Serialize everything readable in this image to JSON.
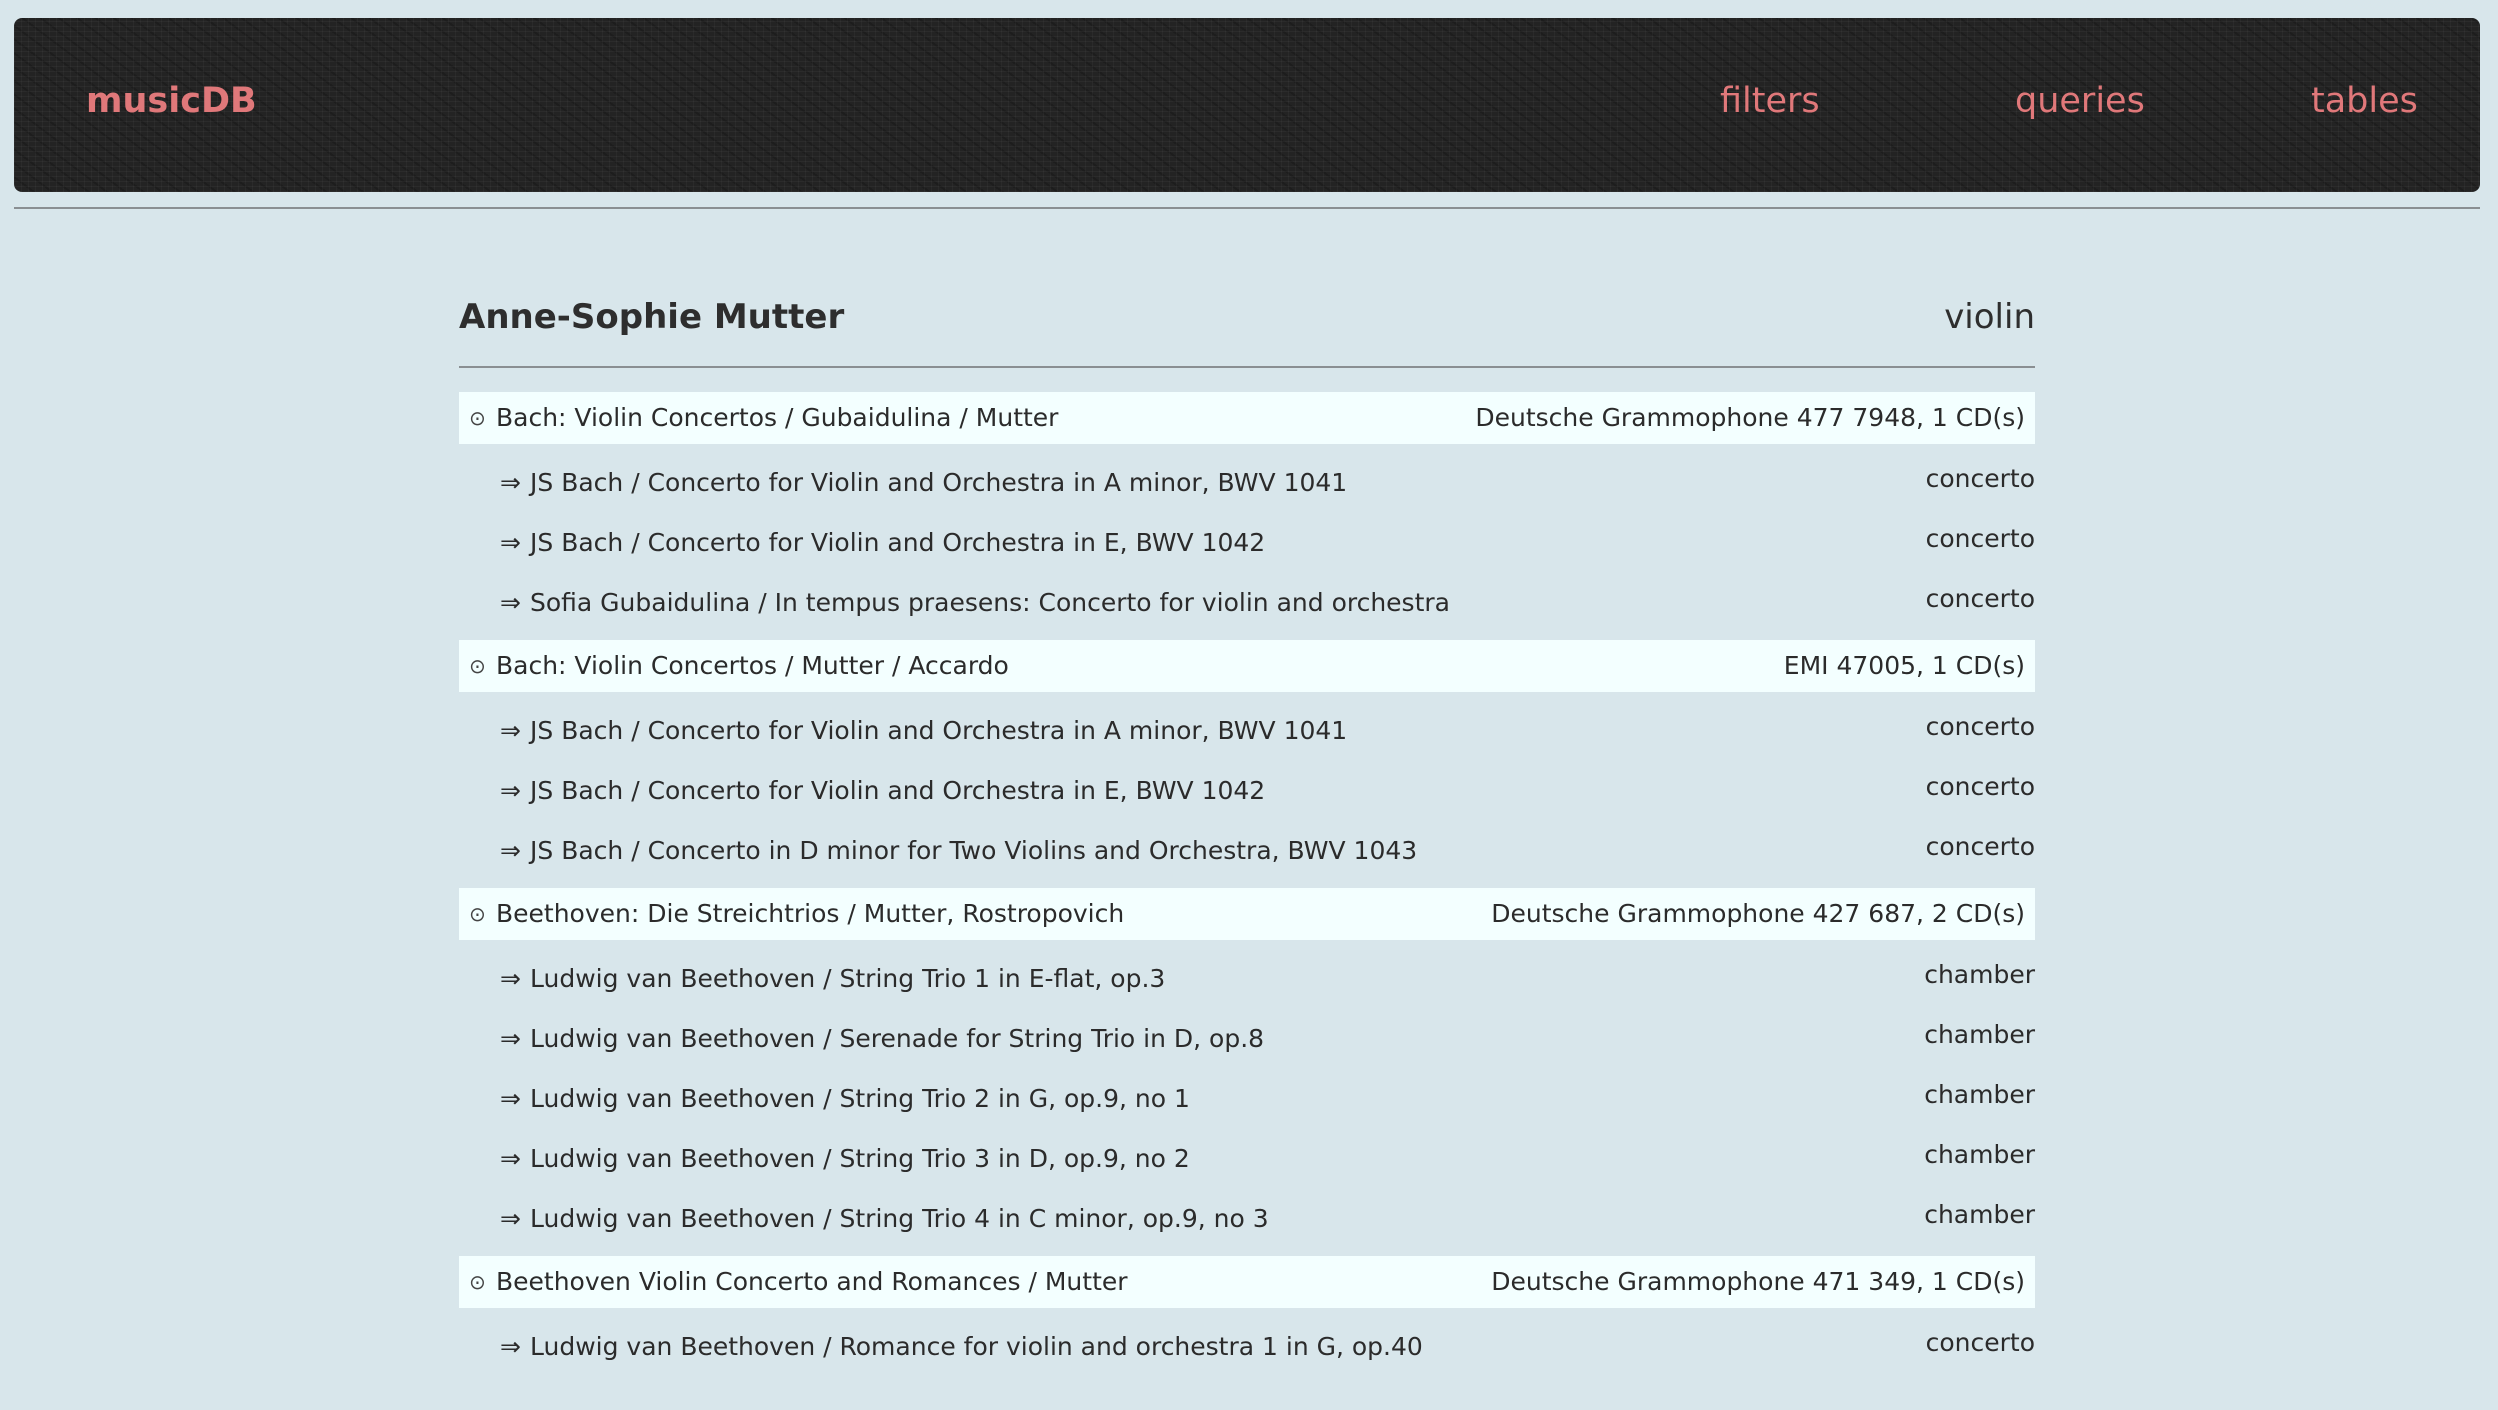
{
  "nav": {
    "brand": "musicDB",
    "links": [
      "filters",
      "queries",
      "tables"
    ]
  },
  "artist": {
    "name": "Anne-Sophie Mutter",
    "instrument": "violin"
  },
  "icons": {
    "album": "collapse-circle-icon",
    "track": "double-arrow-right-icon"
  },
  "glyphs": {
    "album": "⊙",
    "track": "⇒"
  },
  "albums": [
    {
      "title": "Bach: Violin Concertos / Gubaidulina / Mutter",
      "label": "Deutsche Grammophone 477 7948, 1 CD(s)",
      "tracks": [
        {
          "title": "JS Bach / Concerto for Violin and Orchestra in A minor, BWV 1041",
          "genre": "concerto"
        },
        {
          "title": "JS Bach / Concerto for Violin and Orchestra in E, BWV 1042",
          "genre": "concerto"
        },
        {
          "title": "Sofia Gubaidulina / In tempus praesens: Concerto for violin and orchestra",
          "genre": "concerto"
        }
      ]
    },
    {
      "title": "Bach: Violin Concertos / Mutter / Accardo",
      "label": "EMI 47005, 1 CD(s)",
      "tracks": [
        {
          "title": "JS Bach / Concerto for Violin and Orchestra in A minor, BWV 1041",
          "genre": "concerto"
        },
        {
          "title": "JS Bach / Concerto for Violin and Orchestra in E, BWV 1042",
          "genre": "concerto"
        },
        {
          "title": "JS Bach / Concerto in D minor for Two Violins and Orchestra, BWV 1043",
          "genre": "concerto"
        }
      ]
    },
    {
      "title": "Beethoven: Die Streichtrios / Mutter, Rostropovich",
      "label": "Deutsche Grammophone 427 687, 2 CD(s)",
      "tracks": [
        {
          "title": "Ludwig van Beethoven / String Trio 1 in E-flat, op.3",
          "genre": "chamber"
        },
        {
          "title": "Ludwig van Beethoven / Serenade for String Trio in D, op.8",
          "genre": "chamber"
        },
        {
          "title": "Ludwig van Beethoven / String Trio 2 in G, op.9, no 1",
          "genre": "chamber"
        },
        {
          "title": "Ludwig van Beethoven / String Trio 3 in D, op.9, no 2",
          "genre": "chamber"
        },
        {
          "title": "Ludwig van Beethoven / String Trio 4 in C minor, op.9, no 3",
          "genre": "chamber"
        }
      ]
    },
    {
      "title": "Beethoven Violin Concerto and Romances / Mutter",
      "label": "Deutsche Grammophone 471 349, 1 CD(s)",
      "tracks": [
        {
          "title": "Ludwig van Beethoven / Romance for violin and orchestra 1 in G, op.40",
          "genre": "concerto"
        }
      ]
    }
  ]
}
